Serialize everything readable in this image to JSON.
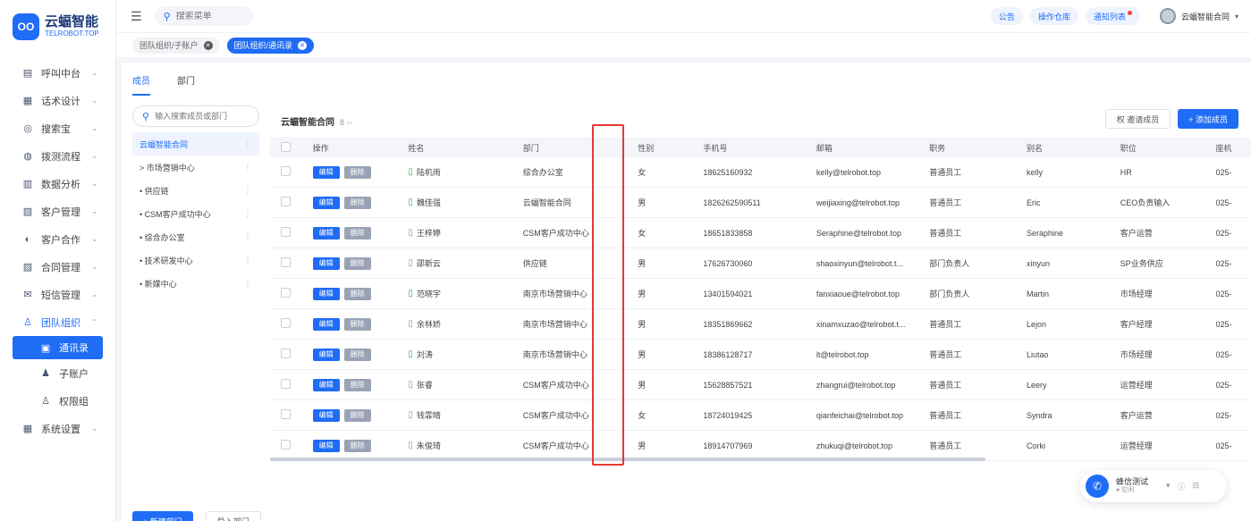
{
  "brand": {
    "mark": "OO",
    "name": "云蝠智能",
    "sub": "TELROBOT.TOP"
  },
  "sidebar": {
    "items": [
      {
        "label": "呼叫中台",
        "icon": "▤"
      },
      {
        "label": "话术设计",
        "icon": "▦"
      },
      {
        "label": "搜索宝",
        "icon": "◎"
      },
      {
        "label": "拨测流程",
        "icon": "◍"
      },
      {
        "label": "数据分析",
        "icon": "▥"
      },
      {
        "label": "客户管理",
        "icon": "▧"
      },
      {
        "label": "客户合作",
        "icon": "◐"
      },
      {
        "label": "合同管理",
        "icon": "▨"
      },
      {
        "label": "短信管理",
        "icon": "✉"
      },
      {
        "label": "团队组织",
        "icon": "♙"
      },
      {
        "label": "通讯录",
        "icon": "▣"
      },
      {
        "label": "子账户",
        "icon": "♟"
      },
      {
        "label": "权限组",
        "icon": "♙"
      },
      {
        "label": "系统设置",
        "icon": "▦"
      }
    ]
  },
  "header": {
    "search_placeholder": "搜索菜单",
    "pills": [
      "公告",
      "操作仓库",
      "通知列表"
    ],
    "user_name": "云蝠智能合同"
  },
  "page_tabs": [
    "团队组织/子账户",
    "团队组织/通讯录"
  ],
  "subtabs": [
    "成员",
    "部门"
  ],
  "tree": {
    "search_placeholder": "输入搜索成员或部门",
    "nodes": [
      "云蝠智能合同",
      "> 市场营销中心",
      "• 供应链",
      "• CSM客户成功中心",
      "• 综合办公室",
      "• 技术研发中心",
      "• 新媒中心"
    ],
    "add_dept": "+ 新建部门",
    "import_dept": "导入部门"
  },
  "panel": {
    "title": "云蝠智能合同",
    "subtitle": "8 ◦◦",
    "btn_view": "权 邀请成员",
    "btn_add": "+ 添加成员"
  },
  "table": {
    "headers": [
      "",
      "操作",
      "姓名",
      "部门",
      "性别",
      "手机号",
      "邮箱",
      "职务",
      "别名",
      "职位",
      "座机"
    ],
    "edit_label": "编辑",
    "del_label": "删除",
    "rows": [
      {
        "name": "陆机雨",
        "dept": "综合办公室",
        "gender": "女",
        "phone": "18625160932",
        "email": "kelly@telrobot.top",
        "role": "普通员工",
        "alias": "kelly",
        "post": "HR",
        "other": "025-",
        "device_on": true
      },
      {
        "name": "魏佳强",
        "dept": "云蝠智能合同",
        "gender": "男",
        "phone": "18262625905​11",
        "email": "weijiaxing@telrobot.top",
        "role": "普通员工",
        "alias": "Eric",
        "post": "CEO负责输入",
        "other": "025-",
        "device_on": true
      },
      {
        "name": "王梓婷",
        "dept": "CSM客户成功中心",
        "gender": "女",
        "phone": "18651833858",
        "email": "Seraphine@telrobot.top",
        "role": "普通员工",
        "alias": "Seraphine",
        "post": "客户运营",
        "other": "025-",
        "device_on": false
      },
      {
        "name": "邵新云",
        "dept": "供应链",
        "gender": "男",
        "phone": "17626730060",
        "email": "shaoxinyun@telrobot.t...",
        "role": "部门负责人",
        "alias": "xinyun",
        "post": "SP业务供应",
        "other": "025-",
        "device_on": false
      },
      {
        "name": "范晓宇",
        "dept": "南京市场营销中心",
        "gender": "男",
        "phone": "13401594021",
        "email": "fanxiaoue@telrobot.top",
        "role": "部门负责人",
        "alias": "Martin",
        "post": "市场经理",
        "other": "025-",
        "device_on": true
      },
      {
        "name": "余林娇",
        "dept": "南京市场营销中心",
        "gender": "男",
        "phone": "18351869662",
        "email": "xinamxuzao@telrobot.t...",
        "role": "普通员工",
        "alias": "Lejon",
        "post": "客户经理",
        "other": "025-",
        "device_on": false
      },
      {
        "name": "刘涛",
        "dept": "南京市场营销中心",
        "gender": "男",
        "phone": "18386128717",
        "email": "lt@telrobot.top",
        "role": "普通员工",
        "alias": "Liutao",
        "post": "市场经理",
        "other": "025-",
        "device_on": true
      },
      {
        "name": "张睿",
        "dept": "CSM客户成功中心",
        "gender": "男",
        "phone": "15628857521",
        "email": "zhangrui@telrobot.top",
        "role": "普通员工",
        "alias": "Leery",
        "post": "运营经理",
        "other": "025-",
        "device_on": false
      },
      {
        "name": "钱霏晴",
        "dept": "CSM客户成功中心",
        "gender": "女",
        "phone": "18724019425",
        "email": "qianfeichai@telrobot.top",
        "role": "普通员工",
        "alias": "Syndra",
        "post": "客户运营",
        "other": "025-",
        "device_on": false
      },
      {
        "name": "朱俊琦",
        "dept": "CSM客户成功中心",
        "gender": "男",
        "phone": "18914707969",
        "email": "zhukuqi@telrobot.top",
        "role": "普通员工",
        "alias": "Corki",
        "post": "运营经理",
        "other": "025-",
        "device_on": false
      }
    ]
  },
  "callcard": {
    "name": "蜂信测试",
    "status": "● 空闲"
  },
  "colors": {
    "accent": "#1f6cf5",
    "highlight": "#e53935",
    "online": "#2bb24c"
  }
}
